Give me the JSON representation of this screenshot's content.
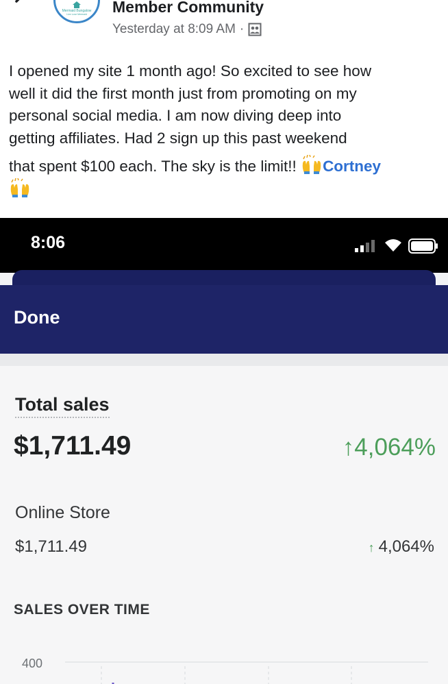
{
  "post": {
    "group_name": "Member Community",
    "avatar_name": "Mermaid Bungalow",
    "avatar_tagline": "Live Love Mermaid",
    "timestamp": "Yesterday at 8:09 AM",
    "meta_separator": "·",
    "privacy_icon": "group-icon",
    "lines": [
      "I opened my site 1 month ago!  So excited to see how",
      "well it did the first month just from promoting on my",
      "personal social media. I am now diving deep into",
      "getting affiliates. Had 2 sign up this past weekend",
      "that spent $100 each. The sky is the limit!! "
    ],
    "mention": "Cortney",
    "emoji": "raising-hands"
  },
  "screenshot": {
    "status_time": "8:06",
    "done_label": "Done",
    "total_sales_label": "Total sales",
    "total_sales_value": "$1,711.49",
    "total_sales_change": "4,064%",
    "change_arrow": "↑",
    "store_label": "Online Store",
    "store_value": "$1,711.49",
    "store_change": "4,064%",
    "sales_over_time_title": "SALES OVER TIME",
    "chart_tick_top": "400",
    "colors": {
      "nav": "#1e2467",
      "positive": "#4c9e5a",
      "mention": "#2d6fd2"
    }
  }
}
